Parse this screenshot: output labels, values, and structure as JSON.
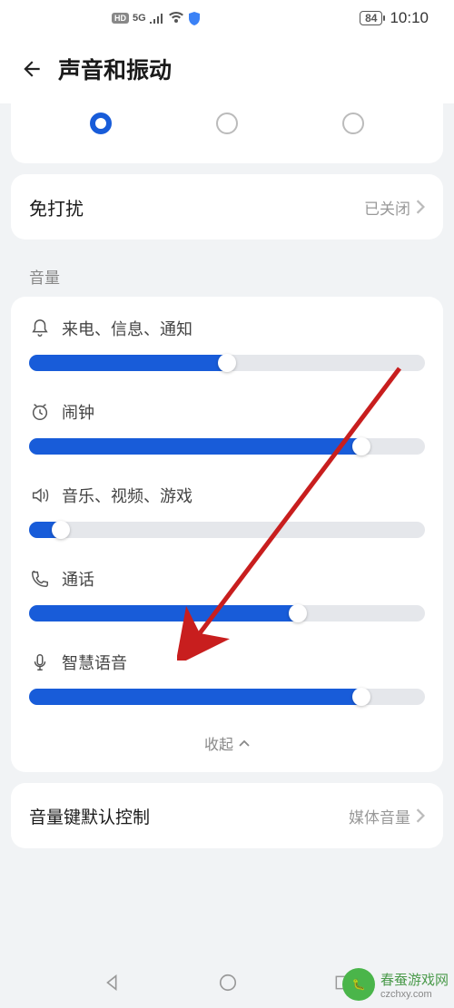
{
  "status": {
    "network": "5G",
    "battery": "84",
    "time": "10:10"
  },
  "header": {
    "title": "声音和振动"
  },
  "dnd": {
    "label": "免打扰",
    "status": "已关闭"
  },
  "volume_section_label": "音量",
  "volumes": [
    {
      "label": "来电、信息、通知",
      "value": 52,
      "icon": "bell"
    },
    {
      "label": "闹钟",
      "value": 86,
      "icon": "clock"
    },
    {
      "label": "音乐、视频、游戏",
      "value": 10,
      "icon": "speaker"
    },
    {
      "label": "通话",
      "value": 70,
      "icon": "phone"
    },
    {
      "label": "智慧语音",
      "value": 86,
      "icon": "mic"
    }
  ],
  "collapse_label": "收起",
  "default_control": {
    "label": "音量键默认控制",
    "value": "媒体音量"
  },
  "watermark": {
    "site": "czchxy.com",
    "name": "春蚕游戏网"
  }
}
